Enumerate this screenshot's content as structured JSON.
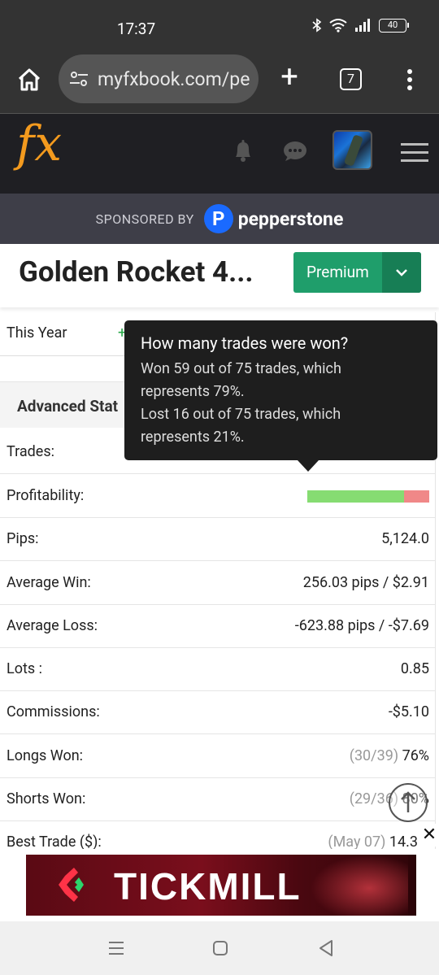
{
  "status_bar": {
    "time": "17:37",
    "battery": "40"
  },
  "browser": {
    "url": "myfxbook.com/pe",
    "tab_count": "7"
  },
  "site": {
    "logo": "fx"
  },
  "sponsor": {
    "label": "SPONSORED BY",
    "brand": "pepperstone",
    "badge": "P"
  },
  "page": {
    "title": "Golden Rocket 4...",
    "premium_label": "Premium"
  },
  "stats": {
    "this_year_label": "This Year",
    "this_year_prefix": "+",
    "advanced_title": "Advanced Stat",
    "trades_label": "Trades:",
    "profitability_label": "Profitability:",
    "profitability_won_fraction": 0.79,
    "rows": [
      {
        "label": "Pips:",
        "value": "5,124.0"
      },
      {
        "label": "Average Win:",
        "value": "256.03 pips / $2.91"
      },
      {
        "label": "Average Loss:",
        "value": "-623.88 pips / -$7.69"
      },
      {
        "label": "Lots :",
        "value": "0.85"
      },
      {
        "label": "Commissions:",
        "value": "-$5.10"
      },
      {
        "label": "Longs Won:",
        "muted": "(30/39)",
        "value": "76%"
      },
      {
        "label": "Shorts Won:",
        "muted": "(29/36)",
        "value": "80%"
      },
      {
        "label": "Best Trade ($):",
        "muted": "(May 07)",
        "value": "14.3"
      }
    ]
  },
  "tooltip": {
    "title": "How many trades were won?",
    "line1": "Won 59 out of 75 trades, which",
    "line2": "represents 79%.",
    "line3": "Lost 16 out of 75 trades, which",
    "line4": "represents 21%."
  },
  "ad": {
    "brand": "TICKMILL",
    "close": "✕"
  },
  "colors": {
    "accent_green": "#1f9e6b",
    "logo_orange": "#f39a1e",
    "won": "#86dc72",
    "lost": "#f08888"
  },
  "icons": [
    "home-icon",
    "tune-icon",
    "plus-icon",
    "tabs-icon",
    "more-vert-icon",
    "bell-icon",
    "chat-icon",
    "hamburger-icon",
    "chevron-down-icon",
    "arrow-up-icon",
    "nav-recents-icon",
    "nav-home-icon",
    "nav-back-icon"
  ]
}
